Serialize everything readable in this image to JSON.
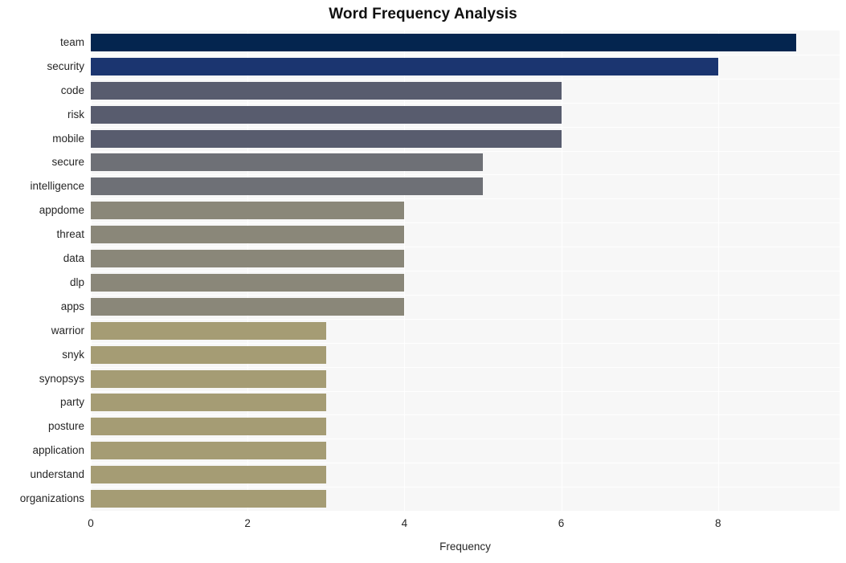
{
  "chart_data": {
    "type": "bar",
    "orientation": "horizontal",
    "title": "Word Frequency Analysis",
    "xlabel": "Frequency",
    "ylabel": "",
    "categories": [
      "team",
      "security",
      "code",
      "risk",
      "mobile",
      "secure",
      "intelligence",
      "appdome",
      "threat",
      "data",
      "dlp",
      "apps",
      "warrior",
      "snyk",
      "synopsys",
      "party",
      "posture",
      "application",
      "understand",
      "organizations"
    ],
    "values": [
      9,
      8,
      6,
      6,
      6,
      5,
      5,
      4,
      4,
      4,
      4,
      4,
      3,
      3,
      3,
      3,
      3,
      3,
      3,
      3
    ],
    "bar_colors": [
      "#04254f",
      "#1b3570",
      "#585c6e",
      "#585c6e",
      "#585c6e",
      "#6e7076",
      "#6e7076",
      "#8a8779",
      "#8a8779",
      "#8a8779",
      "#8a8779",
      "#8a8779",
      "#a59c74",
      "#a59c74",
      "#a59c74",
      "#a59c74",
      "#a59c74",
      "#a59c74",
      "#a59c74",
      "#a59c74"
    ],
    "xlim": [
      0,
      9.55
    ],
    "xticks": [
      0,
      2,
      4,
      6,
      8
    ],
    "xtick_labels": [
      "0",
      "2",
      "4",
      "6",
      "8"
    ],
    "grid": true,
    "grid_color": "#ffffff",
    "plot_background": "#f7f7f7",
    "figure_background": "#ffffff",
    "legend": null
  }
}
